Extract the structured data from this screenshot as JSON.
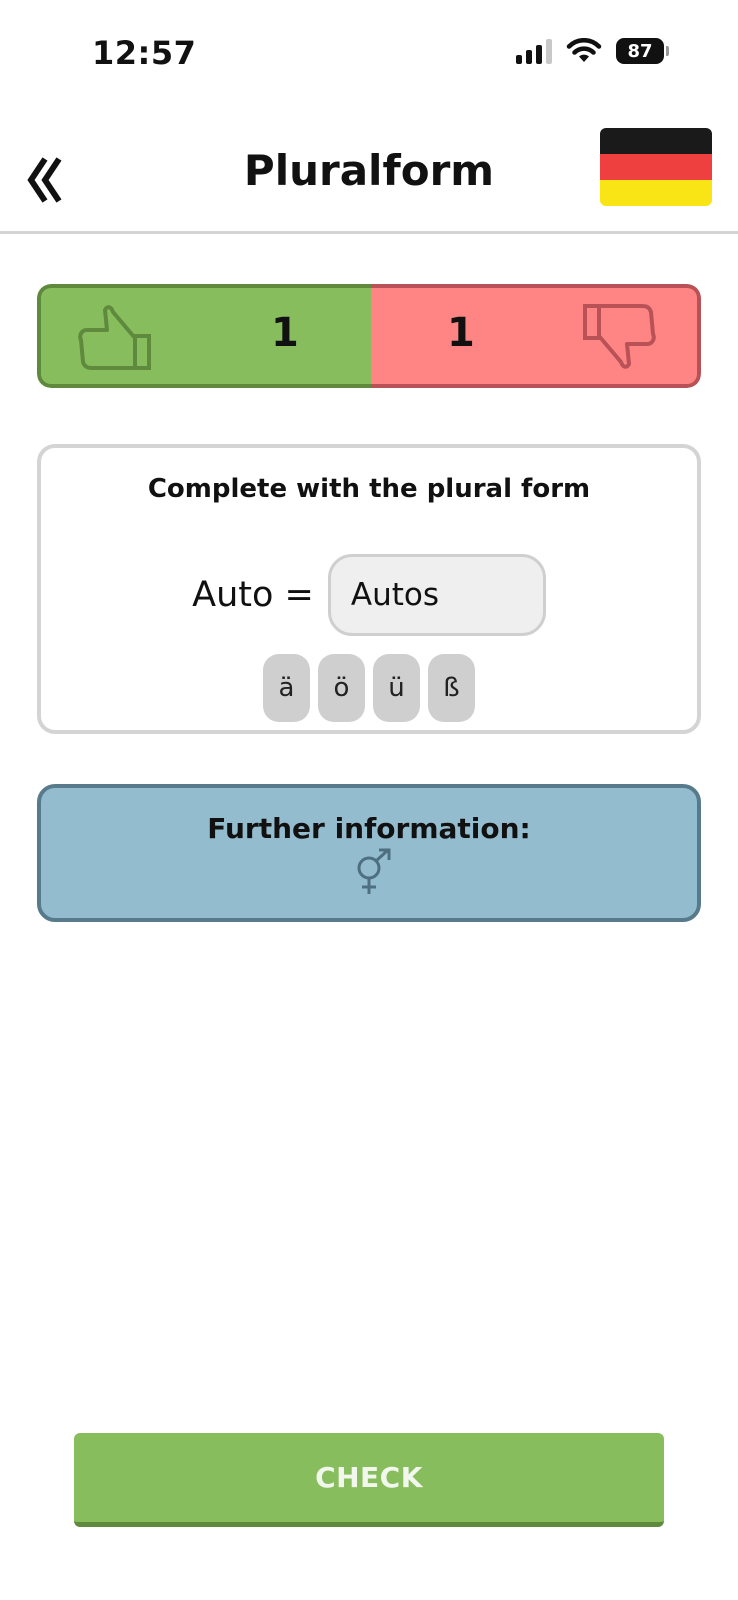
{
  "status_bar": {
    "time": "12:57",
    "battery": "87",
    "icons": [
      "signal-icon",
      "wifi-icon",
      "battery-icon"
    ]
  },
  "header": {
    "title": "Pluralform",
    "back_icon": "double-chevron-left-icon",
    "language_flag": "german-flag-icon",
    "flag_colors": [
      "#1a1a1a",
      "#ef4040",
      "#f9e415"
    ]
  },
  "score": {
    "correct_count": "1",
    "wrong_count": "1",
    "correct_icon": "thumbs-up-icon",
    "wrong_icon": "thumbs-down-icon",
    "correct_color": "#88bd5e",
    "wrong_color": "#ff8585"
  },
  "exercise": {
    "instruction": "Complete with the plural form",
    "word": "Auto",
    "equals": "=",
    "answer_value": "Autos",
    "special_keys": [
      "ä",
      "ö",
      "ü",
      "ß"
    ]
  },
  "info": {
    "title": "Further information:",
    "icon": "gender-neutral-icon",
    "color": "#94bccf"
  },
  "check_button": {
    "label": "CHECK",
    "color": "#88bd5e"
  }
}
